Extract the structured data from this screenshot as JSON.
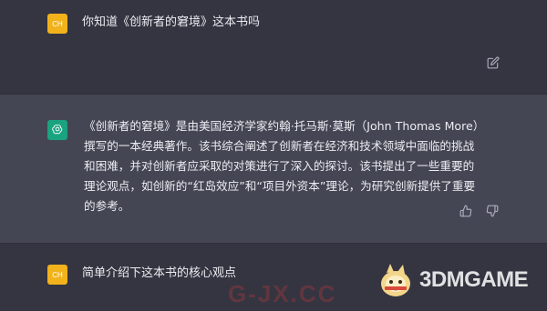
{
  "conversation": {
    "messages": [
      {
        "role": "user",
        "avatar": "CH",
        "text": "你知道《创新者的窘境》这本书吗",
        "icon": "edit-icon"
      },
      {
        "role": "assistant",
        "avatar_icon": "openai-logo-icon",
        "text": "《创新者的窘境》是由美国经济学家约翰·托马斯·莫斯（John Thomas More）撰写的一本经典著作。该书综合阐述了创新者在经济和技术领域中面临的挑战和困难，并对创新者应采取的对策进行了深入的探讨。该书提出了一些重要的理论观点，如创新的“红岛效应”和“项目外资本”理论，为研究创新提供了重要的参考。",
        "actions": [
          "thumbs-up-icon",
          "thumbs-down-icon"
        ]
      },
      {
        "role": "user",
        "avatar": "CH",
        "text": "简单介绍下这本书的核心观点"
      }
    ]
  },
  "watermark": {
    "brand": "3DMGAME",
    "faint": "G-JX.CC"
  },
  "colors": {
    "background": "#343541",
    "assistant_bg": "#444654",
    "user_avatar": "#f1b21b",
    "gpt_avatar": "#19a37f",
    "text": "#ececf1"
  }
}
